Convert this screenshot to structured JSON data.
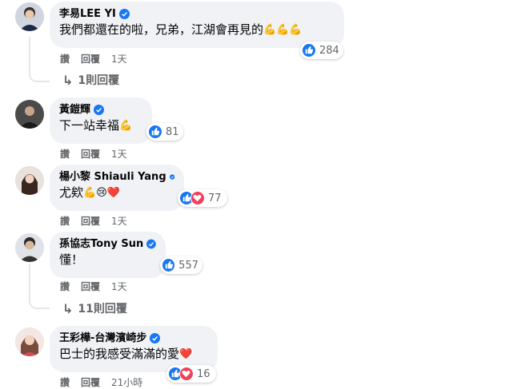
{
  "comments": [
    {
      "author": "李易LEE YI",
      "text": "我們都還在的啦，兄弟，江湖會再見的",
      "emoji": "💪💪💪",
      "reaction_count": "284",
      "actions": {
        "like": "讚",
        "reply": "回覆",
        "time": "1天"
      },
      "replies": "1則回覆",
      "reactions": [
        "like"
      ]
    },
    {
      "author": "黃鎧輝",
      "text": "下一站幸福",
      "emoji": "💪",
      "reaction_count": "81",
      "actions": {
        "like": "讚",
        "reply": "回覆",
        "time": "1天"
      },
      "reactions": [
        "like"
      ]
    },
    {
      "author": "楊小黎 Shiauli Yang",
      "text": "尤欸",
      "emoji": "💪😢❤️",
      "reaction_count": "77",
      "actions": {
        "like": "讚",
        "reply": "回覆",
        "time": "1天"
      },
      "reactions": [
        "like",
        "love"
      ]
    },
    {
      "author": "孫協志Tony Sun",
      "text": "懂！",
      "emoji": "",
      "reaction_count": "557",
      "actions": {
        "like": "讚",
        "reply": "回覆",
        "time": "1天"
      },
      "replies": "11則回覆",
      "reactions": [
        "like"
      ]
    },
    {
      "author": "王彩樺-台灣濱崎步",
      "text": "巴士的我感受滿滿的愛",
      "emoji": "❤️",
      "reaction_count": "16",
      "actions": {
        "like": "讚",
        "reply": "回覆",
        "time": "21小時"
      },
      "reactions": [
        "like",
        "love"
      ]
    }
  ],
  "colors": {
    "bubble": "#f0f2f5",
    "like_blue": "#1877f2",
    "love_red": "#f33e58",
    "meta_gray": "#65676b"
  }
}
